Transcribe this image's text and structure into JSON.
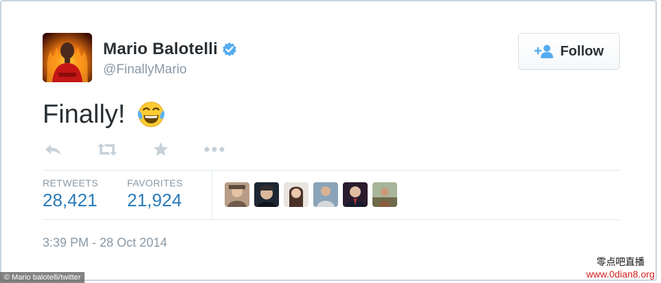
{
  "tweet": {
    "display_name": "Mario Balotelli",
    "screen_name": "@FinallyMario",
    "verified": true,
    "text": "Finally!",
    "emoji": "face-with-tears-of-joy-icon",
    "follow_label": "Follow",
    "stats": {
      "retweets_label": "RETWEETS",
      "retweets_value": "28,421",
      "favorites_label": "FAVORITES",
      "favorites_value": "21,924"
    },
    "timestamp": "3:39 PM - 28 Oct 2014"
  },
  "actions": [
    "reply-icon",
    "retweet-icon",
    "favorite-star-icon",
    "more-dots-icon"
  ],
  "favoriters_count_shown": 6,
  "colors": {
    "link_blue": "#2b7bb9",
    "verified_blue": "#55acee",
    "muted_gray": "#8899a6",
    "text_dark": "#292f33"
  },
  "photo_credit": "© Mario balotelli/twitter",
  "watermark": {
    "cn_text": "零点吧直播",
    "url": "www.0dian8.org"
  }
}
